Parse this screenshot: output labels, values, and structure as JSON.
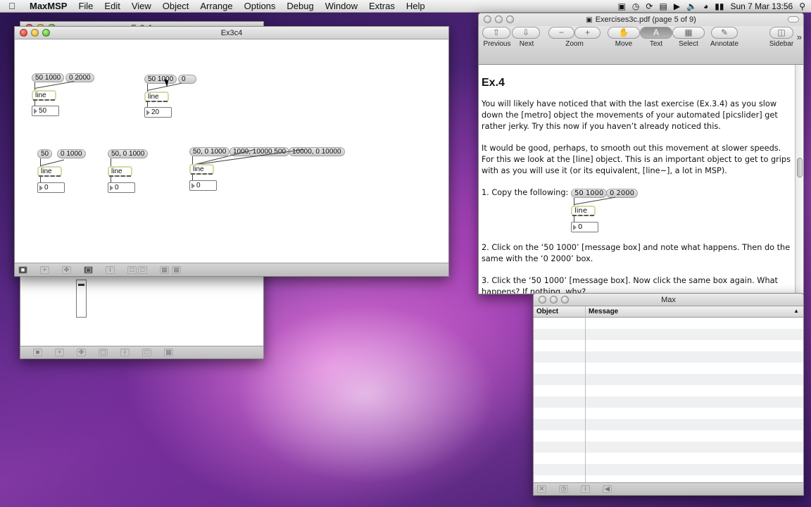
{
  "menubar": {
    "app": "MaxMSP",
    "items": [
      "File",
      "Edit",
      "View",
      "Object",
      "Arrange",
      "Options",
      "Debug",
      "Window",
      "Extras",
      "Help"
    ],
    "clock": "Sun 7 Mar  13:56"
  },
  "patcher_back": {
    "title": "Ex3c1"
  },
  "patcher_front": {
    "title": "Ex3c4",
    "messages": {
      "m1a": "50 1000",
      "m1b": "0 2000",
      "m2a": "50 1000",
      "m2b": "0",
      "m3a": "50",
      "m3b": "0 1000",
      "m4a": "50, 0 1000",
      "m5a": "50, 0 1000",
      "m5b": "1000, 10000 500",
      "m5c": "10000, 0 10000"
    },
    "object_label": "line",
    "numbers": {
      "n1": "50",
      "n2": "20",
      "n3": "0",
      "n4": "0",
      "n5": "0"
    }
  },
  "preview": {
    "title": "Exercises3c.pdf (page 5 of 9)",
    "toolbar": {
      "previous": "Previous",
      "next": "Next",
      "zoom": "Zoom",
      "move": "Move",
      "text": "Text",
      "select": "Select",
      "annotate": "Annotate",
      "sidebar": "Sidebar"
    },
    "heading": "Ex.4",
    "p1": "You will likely have noticed that with the last exercise (Ex.3.4) as you slow down the [metro] object the movements of your automated [picslider] get rather jerky. Try this now if you haven’t already noticed this.",
    "p2": "It would be good, perhaps, to smooth out this movement at slower speeds. For this we look at the [line] object. This is an important object to get to grips with as you will use it (or its equivalent, [line~], a lot in MSP).",
    "step1": "1. Copy the following:",
    "ex_msg_a": "50 1000",
    "ex_msg_b": "0 2000",
    "ex_obj": "line",
    "ex_num": "0",
    "p3": "2. Click on the ‘50 1000’ [message box] and note what happens. Then do the same with the ‘0 2000’ box.",
    "p4": "3. Click the ‘50 1000’ [message box]. Now click the same box again. What happens? If nothing, why?"
  },
  "console": {
    "title": "Max",
    "col_object": "Object",
    "col_message": "Message"
  }
}
